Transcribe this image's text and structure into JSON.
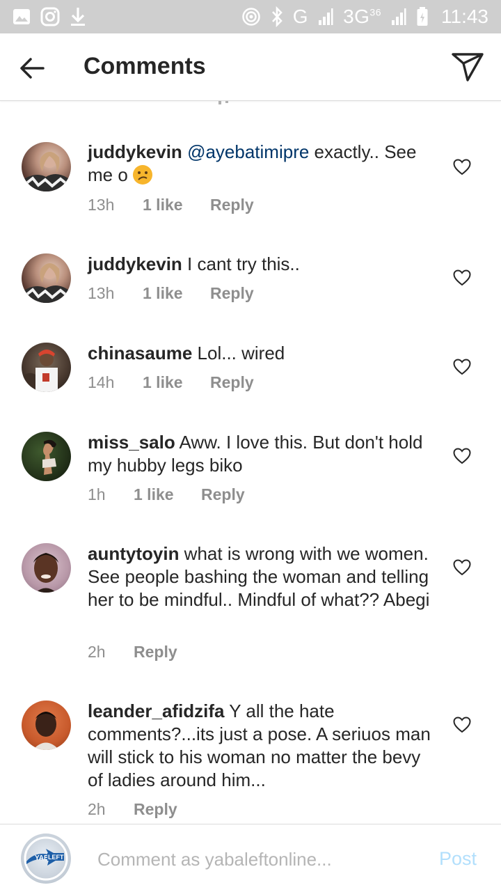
{
  "status_bar": {
    "network_text": "G",
    "network_text_2": "3G",
    "network_sup": "36",
    "time": "11:43"
  },
  "header": {
    "title": "Comments",
    "back_icon": "arrow-left-icon",
    "send_icon": "paper-plane-icon"
  },
  "comments": [
    {
      "username": "juddykevin",
      "mention": "@ayebatimipre",
      "text": " exactly.. See me o",
      "time": "13h",
      "likes": "1 like",
      "reply": "Reply"
    },
    {
      "username": "juddykevin",
      "text": " I cant try this..",
      "time": "13h",
      "likes": "1 like",
      "reply": "Reply"
    },
    {
      "username": "chinasaume",
      "text": " Lol... wired",
      "time": "14h",
      "likes": "1 like",
      "reply": "Reply"
    },
    {
      "username": "miss_salo",
      "text": " Aww. I love this. But don't hold my hubby legs biko",
      "time": "1h",
      "likes": "1 like",
      "reply": "Reply"
    },
    {
      "username": "auntytoyin",
      "text": " what is wrong with we women. See people bashing the woman and telling her to be mindful.. Mindful of what?? Abegi",
      "time": "2h",
      "reply": "Reply"
    },
    {
      "username": "leander_afidzifa",
      "text": " Y all the hate comments?...its just a pose.  A seriuos man will stick to his woman no matter the bevy of ladies around him...",
      "time": "2h",
      "reply": "Reply"
    }
  ],
  "composer": {
    "placeholder": "Comment as yabaleftonline...",
    "post_label": "Post",
    "avatar_text": "YABA LEFT"
  },
  "colors": {
    "status_bar_bg": "#cfcfcf",
    "text_primary": "#262626",
    "text_secondary": "#8e8e8e",
    "mention": "#003569",
    "post_disabled": "#b2dffc",
    "emoji": "#f7b52c"
  }
}
